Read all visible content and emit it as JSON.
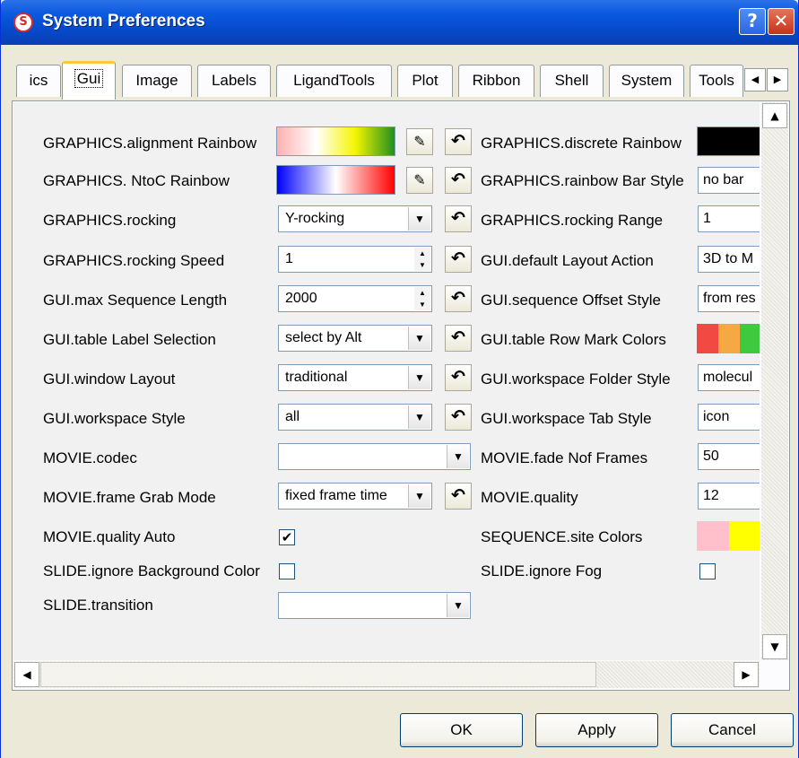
{
  "window": {
    "title": "System Preferences",
    "help_label": "?",
    "close_label": "✕"
  },
  "tabs": [
    "ics",
    "Gui",
    "Image",
    "Labels",
    "LigandTools",
    "Plot",
    "Ribbon",
    "Shell",
    "System",
    "Tools"
  ],
  "active_tab": "Gui",
  "left_prefs": {
    "alignment_rainbow": "GRAPHICS.alignment Rainbow",
    "ntoc_rainbow": "GRAPHICS. NtoC Rainbow",
    "rocking": "GRAPHICS.rocking",
    "rocking_speed": "GRAPHICS.rocking Speed",
    "max_sequence_length": "GUI.max Sequence Length",
    "table_label_selection": "GUI.table Label Selection",
    "window_layout": "GUI.window Layout",
    "workspace_style": "GUI.workspace Style",
    "movie_codec": "MOVIE.codec",
    "frame_grab_mode": "MOVIE.frame Grab Mode",
    "quality_auto": "MOVIE.quality Auto",
    "ignore_bg_color": "SLIDE.ignore Background Color",
    "transition": "SLIDE.transition"
  },
  "left_values": {
    "rocking": "Y-rocking",
    "rocking_speed": "1",
    "max_sequence_length": "2000",
    "table_label_selection": "select by Alt",
    "window_layout": "traditional",
    "workspace_style": "all",
    "movie_codec": "",
    "frame_grab_mode": "fixed frame time",
    "transition": ""
  },
  "right_prefs": {
    "discrete_rainbow": "GRAPHICS.discrete Rainbow",
    "rainbow_bar_style": "GRAPHICS.rainbow Bar Style",
    "rocking_range": "GRAPHICS.rocking Range",
    "default_layout_action": "GUI.default Layout Action",
    "sequence_offset_style": "GUI.sequence Offset Style",
    "table_row_mark_colors": "GUI.table Row Mark Colors",
    "workspace_folder_style": "GUI.workspace Folder Style",
    "workspace_tab_style": "GUI.workspace Tab Style",
    "fade_nof_frames": "MOVIE.fade Nof Frames",
    "movie_quality": "MOVIE.quality",
    "site_colors": "SEQUENCE.site Colors",
    "ignore_fog": "SLIDE.ignore Fog"
  },
  "right_values": {
    "rainbow_bar_style": "no bar",
    "rocking_range": "1",
    "default_layout_action": "3D to M",
    "sequence_offset_style": "from res",
    "workspace_folder_style": "molecul",
    "workspace_tab_style": "icon",
    "fade_nof_frames": "50",
    "movie_quality": "12"
  },
  "checkbox_state": {
    "quality_auto": true,
    "ignore_bg_color": false,
    "ignore_fog": false
  },
  "colors": {
    "alignment_rainbow": [
      "#ffb0b0",
      "#ffffff",
      "#f5f500",
      "#1f8f1f"
    ],
    "ntoc_rainbow": [
      "#0000ff",
      "#ffffff",
      "#ff0000"
    ],
    "discrete_rainbow": "#000000",
    "table_row_mark": [
      "#f24a42",
      "#f5a945",
      "#3fc93f"
    ],
    "site_colors": [
      "#ffc0cb",
      "#ffff00"
    ]
  },
  "buttons": {
    "ok": "OK",
    "apply": "Apply",
    "cancel": "Cancel"
  },
  "icons": {
    "edit": "✎",
    "reset": "↶"
  }
}
